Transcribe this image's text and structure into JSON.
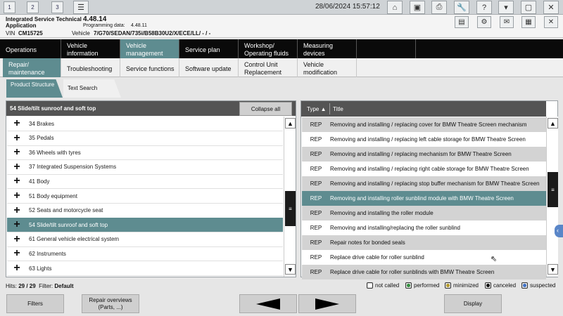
{
  "topbar": {
    "tabs": [
      "1",
      "2",
      "3"
    ],
    "datetime": "28/06/2024 15:57:12",
    "icons": [
      "list-icon",
      "home-icon",
      "screens-icon",
      "printer-icon",
      "wrench-icon",
      "help-icon",
      "minimize-icon",
      "restore-icon",
      "close-icon"
    ]
  },
  "app": {
    "name_line1": "Integrated Service Technical",
    "name_line2": "Application",
    "version": "4.48.14",
    "programming_label": "Programming data:",
    "programming_version": "4.48.11",
    "vin_label": "VIN",
    "vin": "CM15725",
    "vehicle_label": "Vehicle",
    "vehicle": "7/G70/SEDAN/735i/B58B30U2/X/ECE/LL/ - / -"
  },
  "nav_primary": [
    {
      "label": "Operations",
      "active": false
    },
    {
      "label": "Vehicle information",
      "active": false
    },
    {
      "label": "Vehicle management",
      "active": true
    },
    {
      "label": "Service plan",
      "active": false
    },
    {
      "label": "Workshop/ Operating fluids",
      "active": false
    },
    {
      "label": "Measuring devices",
      "active": false
    }
  ],
  "nav_secondary": [
    {
      "label": "Repair/ maintenance",
      "active": true
    },
    {
      "label": "Troubleshooting",
      "active": false
    },
    {
      "label": "Service functions",
      "active": false
    },
    {
      "label": "Software update",
      "active": false
    },
    {
      "label": "Control Unit Replacement",
      "active": false
    },
    {
      "label": "Vehicle modification",
      "active": false
    }
  ],
  "subtabs": {
    "product_structure": "Product Structure",
    "text_search": "Text Search"
  },
  "left_panel": {
    "header": "54 Slide/tilt sunroof and soft top",
    "collapse_label": "Collapse all",
    "items": [
      {
        "label": "34 Brakes",
        "selected": false
      },
      {
        "label": "35 Pedals",
        "selected": false
      },
      {
        "label": "36 Wheels with tyres",
        "selected": false
      },
      {
        "label": "37 Integrated Suspension Systems",
        "selected": false
      },
      {
        "label": "41 Body",
        "selected": false
      },
      {
        "label": "51 Body equipment",
        "selected": false
      },
      {
        "label": "52 Seats and motorcycle seat",
        "selected": false
      },
      {
        "label": "54 Slide/tilt sunroof and soft top",
        "selected": true
      },
      {
        "label": "61 General vehicle electrical system",
        "selected": false
      },
      {
        "label": "62 Instruments",
        "selected": false
      },
      {
        "label": "63 Lights",
        "selected": false
      }
    ]
  },
  "right_panel": {
    "col_type": "Type",
    "sort_indicator": "▲",
    "col_title": "Title",
    "rows": [
      {
        "type": "REP",
        "title": "Removing and installing / replacing cover for BMW Theatre Screen mechanism",
        "selected": false
      },
      {
        "type": "REP",
        "title": "Removing and installing / replacing left cable storage for BMW Theatre Screen",
        "selected": false
      },
      {
        "type": "REP",
        "title": "Removing and installing / replacing mechanism for BMW Theatre Screen",
        "selected": false
      },
      {
        "type": "REP",
        "title": "Removing and installing / replacing right cable storage for BMW Theatre Screen",
        "selected": false
      },
      {
        "type": "REP",
        "title": "Removing and installing / replacing stop buffer mechanism for BMW Theatre Screen",
        "selected": false
      },
      {
        "type": "REP",
        "title": "Removing and installing roller sunblind module with BMW Theatre Screen",
        "selected": true
      },
      {
        "type": "REP",
        "title": "Removing and installing the roller module",
        "selected": false
      },
      {
        "type": "REP",
        "title": "Removing and installing/replacing the roller sunblind",
        "selected": false
      },
      {
        "type": "REP",
        "title": "Repair notes for bonded seals",
        "selected": false
      },
      {
        "type": "REP",
        "title": "Replace drive cable for roller sunblind",
        "selected": false
      },
      {
        "type": "REP",
        "title": "Replace drive cable for roller sunblinds with BMW Theatre Screen",
        "selected": false
      }
    ]
  },
  "status": {
    "hits_label": "Hits:",
    "hits": "29 / 29",
    "filter_label": "Filter:",
    "filter": "Default"
  },
  "legend": [
    {
      "label": "not called",
      "color": "#ffffff"
    },
    {
      "label": "performed",
      "color": "#2e8b3a"
    },
    {
      "label": "minimized",
      "color": "#b59a2a"
    },
    {
      "label": "canceled",
      "color": "#111111"
    },
    {
      "label": "suspected",
      "color": "#3d6fc4"
    }
  ],
  "bottom_buttons": {
    "filters": "Filters",
    "repair_overviews": "Repair overviews (Parts, ...)",
    "display": "Display"
  },
  "colors": {
    "accent": "#5e8c90",
    "header_dark": "#545454",
    "nav_black": "#0a0a0a"
  }
}
